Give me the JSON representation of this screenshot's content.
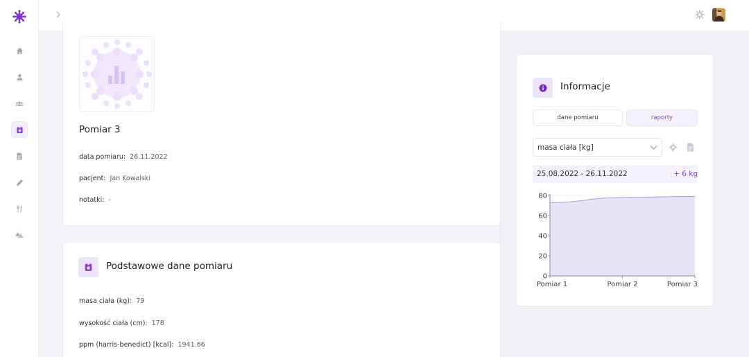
{
  "nav": {
    "items": [
      {
        "icon": "home-icon"
      },
      {
        "icon": "user-icon"
      },
      {
        "icon": "users-icon"
      },
      {
        "icon": "measurement-icon",
        "active": true
      },
      {
        "icon": "document-icon"
      },
      {
        "icon": "pen-icon"
      },
      {
        "icon": "cutlery-icon"
      },
      {
        "icon": "shapes-icon"
      }
    ]
  },
  "measurement": {
    "title": "Pomiar 3",
    "date_label": "data pomiaru:",
    "date_value": "26.11.2022",
    "patient_label": "pacjent:",
    "patient_value": "Jan Kowalski",
    "notes_label": "notatki:",
    "notes_value": "-"
  },
  "basic": {
    "title": "Podstawowe dane pomiaru",
    "mass_label": "masa ciała (kg):",
    "mass_value": "79",
    "height_label": "wysokość ciała (cm):",
    "height_value": "178",
    "ppm_label": "ppm (harris-benedict) [kcal]:",
    "ppm_value": "1941.66"
  },
  "info": {
    "title": "Informacje",
    "tab_data": "dane pomiaru",
    "tab_reports": "raporty",
    "select_value": "masa ciała [kg]",
    "range": "25.08.2022 - 26.11.2022",
    "delta": "+ 6 kg"
  },
  "colors": {
    "accent": "#7d4bc8",
    "accent_light": "#ede4fa"
  },
  "chart_data": {
    "type": "area",
    "categories": [
      "Pomiar 1",
      "Pomiar 2",
      "Pomiar 3"
    ],
    "series": [
      {
        "values": [
          73,
          78,
          79
        ]
      }
    ],
    "ylim": [
      0,
      80
    ],
    "yticks": [
      0,
      20,
      40,
      60,
      80
    ],
    "grid": true
  }
}
